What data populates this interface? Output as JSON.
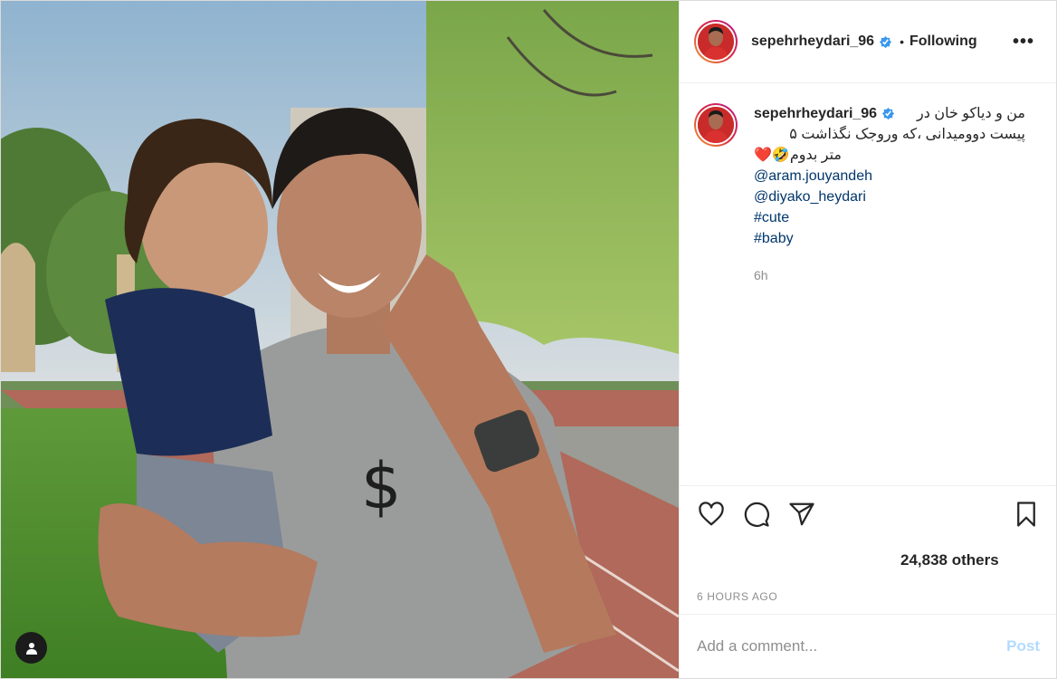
{
  "header": {
    "username": "sepehrheydari_96",
    "separator": "•",
    "follow_label": "Following",
    "more_label": "•••"
  },
  "caption": {
    "username": "sepehrheydari_96",
    "fa_line1": "من و دیاکو خان در",
    "fa_line2": "پیست دوومیدانی ،که وروجک نگذاشت ۵",
    "fa_line3": "متر بدوم🤣❤️",
    "mentions": [
      "@aram.jouyandeh",
      "@diyako_heydari"
    ],
    "hashtags": [
      "#cute",
      "#baby"
    ],
    "age": "6h"
  },
  "likes": {
    "label": "24,838 others"
  },
  "timestamp": "6 HOURS AGO",
  "comment": {
    "placeholder": "Add a comment...",
    "post_label": "Post"
  },
  "icons": {
    "verified": "verified-badge-icon",
    "like": "heart-icon",
    "comment": "comment-bubble-icon",
    "share": "paper-plane-icon",
    "save": "bookmark-icon",
    "user_tag": "user-tag-icon",
    "more": "more-options-icon"
  },
  "colors": {
    "verified": "#3897f0",
    "link": "#00376b",
    "post_disabled": "#b3dbff",
    "secondary_text": "#8e8e8e"
  }
}
